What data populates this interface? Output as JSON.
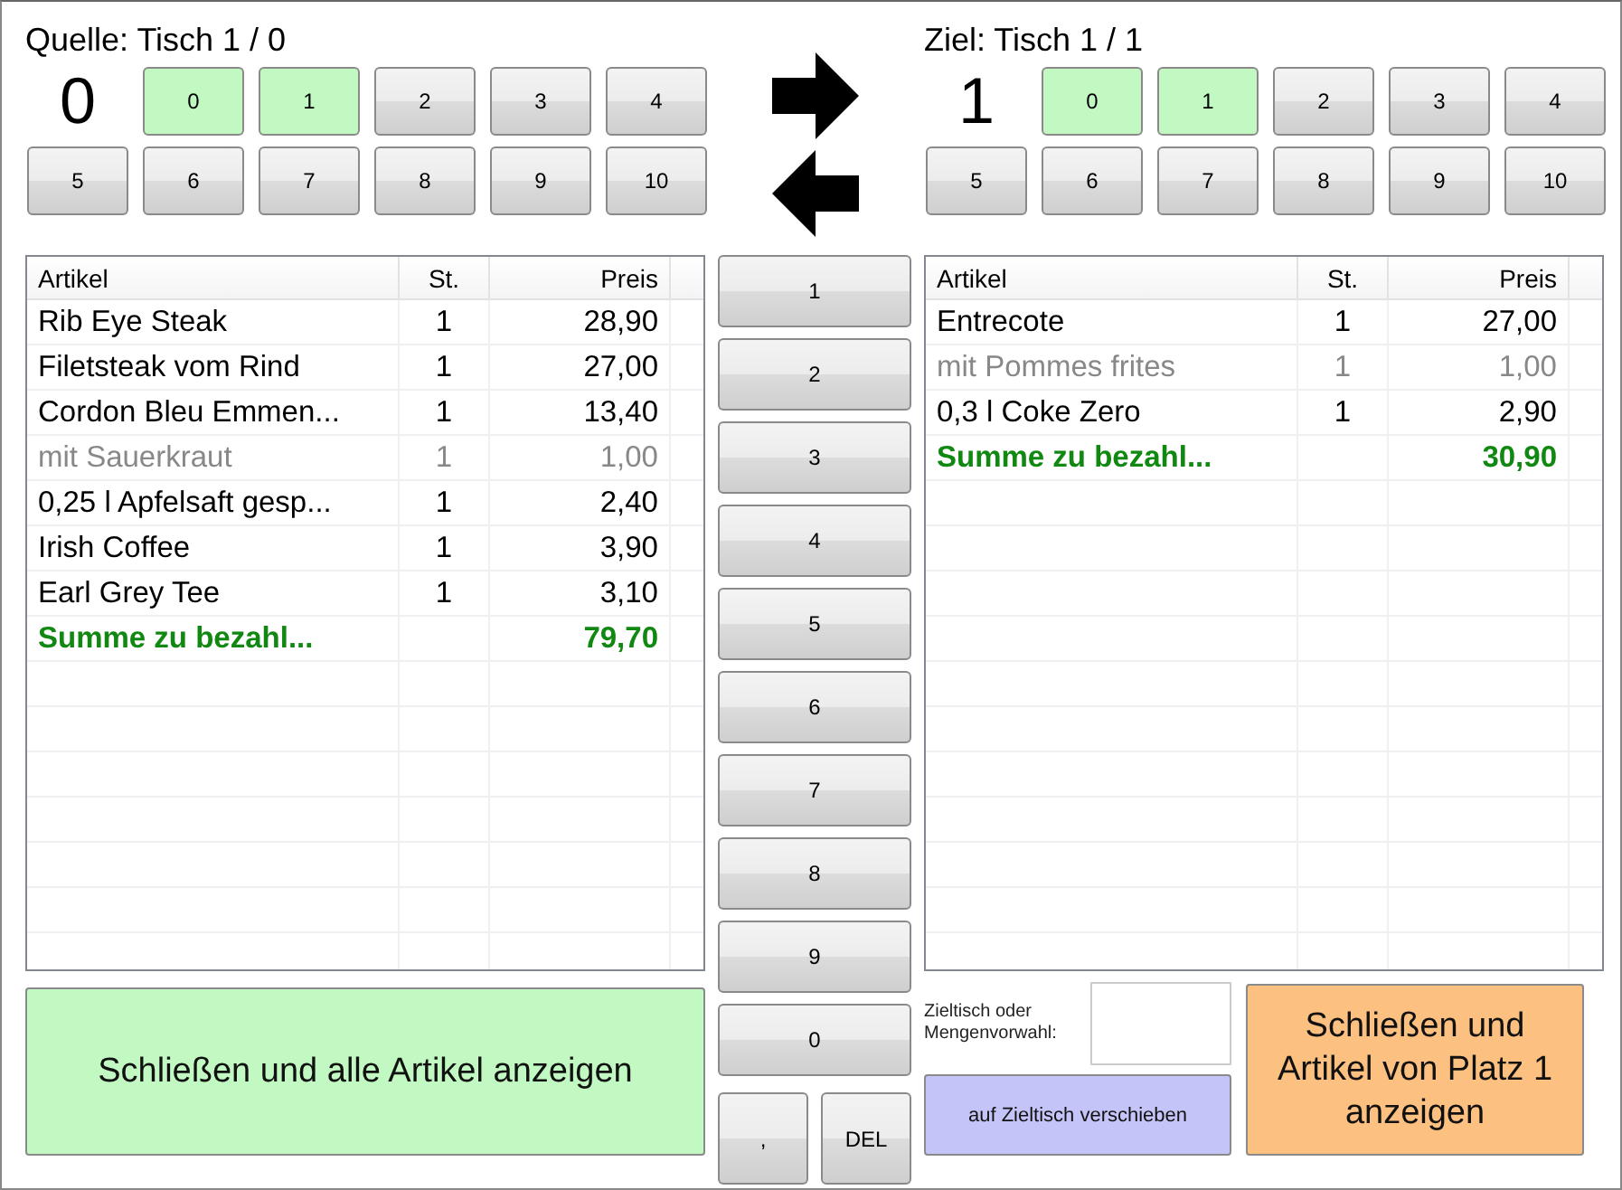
{
  "source": {
    "title": "Quelle: Tisch 1 / 0",
    "current": "0",
    "seats": [
      {
        "label": "0",
        "selected": true
      },
      {
        "label": "1",
        "selected": true
      },
      {
        "label": "2",
        "selected": false
      },
      {
        "label": "3",
        "selected": false
      },
      {
        "label": "4",
        "selected": false
      },
      {
        "label": "5",
        "selected": false
      },
      {
        "label": "6",
        "selected": false
      },
      {
        "label": "7",
        "selected": false
      },
      {
        "label": "8",
        "selected": false
      },
      {
        "label": "9",
        "selected": false
      },
      {
        "label": "10",
        "selected": false
      }
    ]
  },
  "target": {
    "title": "Ziel: Tisch 1 / 1",
    "current": "1",
    "seats": [
      {
        "label": "0",
        "selected": true
      },
      {
        "label": "1",
        "selected": true
      },
      {
        "label": "2",
        "selected": false
      },
      {
        "label": "3",
        "selected": false
      },
      {
        "label": "4",
        "selected": false
      },
      {
        "label": "5",
        "selected": false
      },
      {
        "label": "6",
        "selected": false
      },
      {
        "label": "7",
        "selected": false
      },
      {
        "label": "8",
        "selected": false
      },
      {
        "label": "9",
        "selected": false
      },
      {
        "label": "10",
        "selected": false
      }
    ]
  },
  "source_table": {
    "columns": [
      "Artikel",
      "St.",
      "Preis"
    ],
    "rows": [
      {
        "kind": "item",
        "cells": [
          "Rib Eye Steak",
          "1",
          "28,90"
        ]
      },
      {
        "kind": "item",
        "cells": [
          "Filetsteak vom Rind",
          "1",
          "27,00"
        ]
      },
      {
        "kind": "item",
        "cells": [
          "Cordon Bleu Emmen...",
          "1",
          "13,40"
        ]
      },
      {
        "kind": "addon",
        "cells": [
          "mit Sauerkraut",
          "1",
          "1,00"
        ]
      },
      {
        "kind": "item",
        "cells": [
          "0,25 l Apfelsaft gesp...",
          "1",
          "2,40"
        ]
      },
      {
        "kind": "item",
        "cells": [
          "Irish Coffee",
          "1",
          "3,90"
        ]
      },
      {
        "kind": "item",
        "cells": [
          "Earl Grey Tee",
          "1",
          "3,10"
        ]
      },
      {
        "kind": "total",
        "cells": [
          "Summe zu bezahl...",
          "",
          "79,70"
        ]
      }
    ]
  },
  "keypad": {
    "keys": [
      "1",
      "2",
      "3",
      "4",
      "5",
      "6",
      "7",
      "8",
      "9",
      "0"
    ],
    "bottom_keys": [
      ",",
      "DEL"
    ]
  },
  "target_table": {
    "columns": [
      "Artikel",
      "St.",
      "Preis"
    ],
    "rows": [
      {
        "kind": "item",
        "cells": [
          "Entrecote",
          "1",
          "27,00"
        ]
      },
      {
        "kind": "addon",
        "cells": [
          "mit Pommes frites",
          "1",
          "1,00"
        ]
      },
      {
        "kind": "item",
        "cells": [
          "0,3 l Coke Zero",
          "1",
          "2,90"
        ]
      },
      {
        "kind": "total",
        "cells": [
          "Summe zu bezahl...",
          "",
          "30,90"
        ]
      }
    ]
  },
  "close_all_button": "Schließen und alle Artikel anzeigen",
  "target_input": {
    "label": "Zieltisch oder Mengenvorwahl:"
  },
  "move_button": "auf Zieltisch verschieben",
  "close_seat_button": "Schließen und Artikel von Platz 1 anzeigen"
}
